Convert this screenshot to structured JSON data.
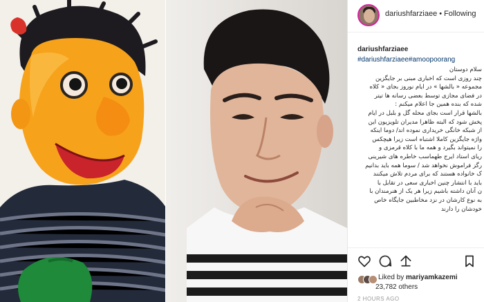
{
  "post": {
    "username": "dariushfarziaee",
    "follow_label": "Following",
    "separator": "•",
    "caption_username": "dariushfarziaee",
    "hashtags": "#dariushfarziaee#amoopoorang",
    "caption_lines": [
      "سلام دوستان",
      "چند روزی است که اخباری مبنی بر جایگزین",
      "مجموعه « بالشها » در ایام نوروز بجای « کلاه",
      "در فضای مجازی توسط بعضی رسانه ها تیتر",
      "شده که بنده همین جا اعلام میکنم :",
      "بالشها قرار است بجای محله گل و بلبل در ایام",
      "پخش شود که البته ظاهرا مدیران تلویزیون این",
      "از شبکه خانگی خریداری نموده اند/ دوما اینکه",
      "واژه جایگزین کاملا اشتباه است زیرا هیچکس",
      "را نمیتواند بگیرد و همه ما با کلاه قرمزی و",
      "ریای استاد ایرج طهماسب خاطره های شیرینی",
      "رگز فراموش نخواهد شد / سوما همه باید بدانیم",
      "ک خانواده هستند که برای مردم تلاش میکنند",
      "باید با انتشار چنین اخباری سعی در تقابل با",
      "ن آنان داشته باشیم زیرا هر یک از هنرمندان با",
      "به نوع کارشان در نزد مخاطبین جایگاه خاص",
      "خودشان را دارند"
    ],
    "liked_by_prefix": "Liked by ",
    "liked_by_user": "mariyamkazemi",
    "views": "23,782 others",
    "time_ago": "2 HOURS AGO"
  },
  "icons": {
    "like": "heart-icon",
    "comment": "comment-icon",
    "share": "share-icon",
    "save": "bookmark-icon"
  },
  "colors": {
    "hashtag": "#003569",
    "story_ring": "#d6249f",
    "puppet_face": "#f7a21b",
    "puppet_sweater": "#232a3a"
  }
}
